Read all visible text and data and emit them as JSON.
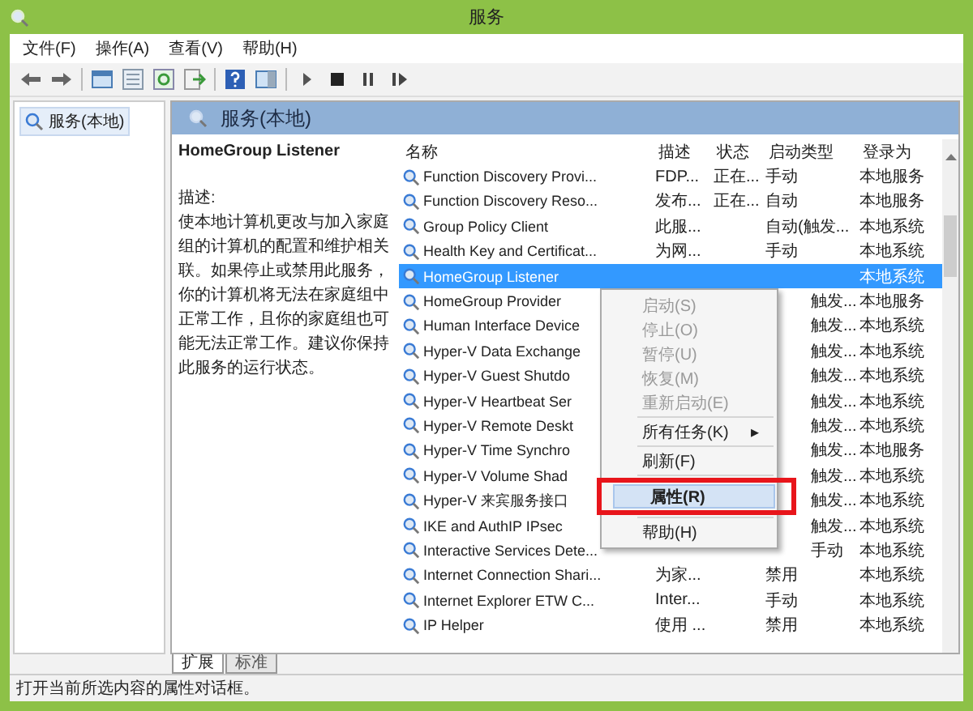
{
  "window": {
    "title": "服务"
  },
  "menu": [
    "文件(F)",
    "操作(A)",
    "查看(V)",
    "帮助(H)"
  ],
  "tree": {
    "items": [
      {
        "label": "服务(本地)",
        "selected": true
      }
    ]
  },
  "pane": {
    "title": "服务(本地)"
  },
  "detail": {
    "name": "HomeGroup Listener",
    "heading": "描述:",
    "text": "使本地计算机更改与加入家庭组的计算机的配置和维护相关联。如果停止或禁用此服务，你的计算机将无法在家庭组中正常工作，且你的家庭组也可能无法正常工作。建议你保持此服务的运行状态。"
  },
  "table": {
    "columns": [
      "名称",
      "描述",
      "状态",
      "启动类型",
      "登录为"
    ],
    "rows": [
      {
        "name": "Function Discovery Provi...",
        "desc": "FDP...",
        "status": "正在...",
        "startup": "手动",
        "logon": "本地服务",
        "selected": false
      },
      {
        "name": "Function Discovery Reso...",
        "desc": "发布...",
        "status": "正在...",
        "startup": "自动",
        "logon": "本地服务",
        "selected": false
      },
      {
        "name": "Group Policy Client",
        "desc": "此服...",
        "status": "",
        "startup": "自动(触发...",
        "logon": "本地系统",
        "selected": false
      },
      {
        "name": "Health Key and Certificat...",
        "desc": "为网...",
        "status": "",
        "startup": "手动",
        "logon": "本地系统",
        "selected": false
      },
      {
        "name": "HomeGroup Listener",
        "desc": "",
        "status": "",
        "startup": "",
        "logon": "本地系统",
        "selected": true
      },
      {
        "name": "HomeGroup Provider",
        "desc": "",
        "status": "",
        "startup": "触发...",
        "logon": "本地服务",
        "selected": false
      },
      {
        "name": "Human Interface Device",
        "desc": "",
        "status": "",
        "startup": "触发...",
        "logon": "本地系统",
        "selected": false
      },
      {
        "name": "Hyper-V Data Exchange",
        "desc": "",
        "status": "",
        "startup": "触发...",
        "logon": "本地系统",
        "selected": false
      },
      {
        "name": "Hyper-V Guest Shutdo",
        "desc": "",
        "status": "",
        "startup": "触发...",
        "logon": "本地系统",
        "selected": false
      },
      {
        "name": "Hyper-V Heartbeat Ser",
        "desc": "",
        "status": "",
        "startup": "触发...",
        "logon": "本地系统",
        "selected": false
      },
      {
        "name": "Hyper-V Remote Deskt",
        "desc": "",
        "status": "",
        "startup": "触发...",
        "logon": "本地系统",
        "selected": false
      },
      {
        "name": "Hyper-V Time Synchro",
        "desc": "",
        "status": "",
        "startup": "触发...",
        "logon": "本地服务",
        "selected": false
      },
      {
        "name": "Hyper-V Volume Shad",
        "desc": "",
        "status": "",
        "startup": "触发...",
        "logon": "本地系统",
        "selected": false
      },
      {
        "name": "Hyper-V 来宾服务接口",
        "desc": "",
        "status": "",
        "startup": "触发...",
        "logon": "本地系统",
        "selected": false
      },
      {
        "name": "IKE and AuthIP IPsec",
        "desc": "",
        "status": "",
        "startup": "触发...",
        "logon": "本地系统",
        "selected": false
      },
      {
        "name": "Interactive Services Dete...",
        "desc": "",
        "status": "",
        "startup": "手动",
        "logon": "本地系统",
        "selected": false
      },
      {
        "name": "Internet Connection Shari...",
        "desc": "为家...",
        "status": "",
        "startup": "禁用",
        "logon": "本地系统",
        "selected": false
      },
      {
        "name": "Internet Explorer ETW C...",
        "desc": "Inter...",
        "status": "",
        "startup": "手动",
        "logon": "本地系统",
        "selected": false
      },
      {
        "name": "IP Helper",
        "desc": "使用 ...",
        "status": "",
        "startup": "禁用",
        "logon": "本地系统",
        "selected": false
      }
    ]
  },
  "context_menu": [
    {
      "kind": "item",
      "label": "启动(S)",
      "disabled": true,
      "selected": false
    },
    {
      "kind": "item",
      "label": "停止(O)",
      "disabled": true,
      "selected": false
    },
    {
      "kind": "item",
      "label": "暂停(U)",
      "disabled": true,
      "selected": false
    },
    {
      "kind": "item",
      "label": "恢复(M)",
      "disabled": true,
      "selected": false
    },
    {
      "kind": "item",
      "label": "重新启动(E)",
      "disabled": true,
      "selected": false
    },
    {
      "kind": "separator"
    },
    {
      "kind": "submenu",
      "label": "所有任务(K)",
      "arrow": "▸",
      "disabled": false,
      "selected": false
    },
    {
      "kind": "separator"
    },
    {
      "kind": "item",
      "label": "刷新(F)",
      "disabled": false,
      "selected": false
    },
    {
      "kind": "separator"
    },
    {
      "kind": "item",
      "label": "属性(R)",
      "disabled": false,
      "selected": true
    },
    {
      "kind": "separator"
    },
    {
      "kind": "item",
      "label": "帮助(H)",
      "disabled": false,
      "selected": false
    }
  ],
  "tabs": [
    {
      "label": "扩展",
      "selected": true
    },
    {
      "label": "标准",
      "selected": false
    }
  ],
  "status_bar": "打开当前所选内容的属性对话框。"
}
